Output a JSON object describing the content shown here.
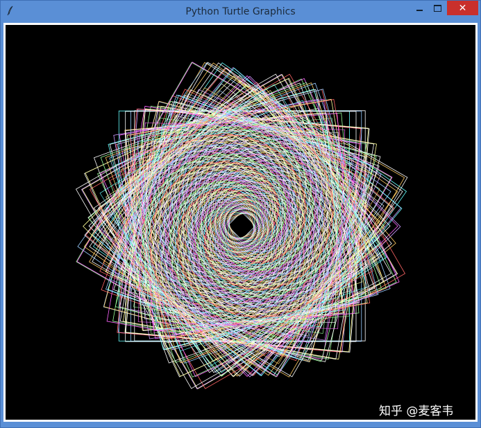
{
  "window": {
    "title": "Python Turtle Graphics",
    "app_icon": "feather-icon",
    "controls": {
      "minimize_icon": "minimize-icon",
      "maximize_icon": "maximize-icon",
      "close_label": "✕"
    }
  },
  "canvas": {
    "background": "#000000",
    "drawing": "turtle-rotating-squares",
    "colors": [
      "#ffffff",
      "#ffff99",
      "#99ff99",
      "#99ccff",
      "#ff6666",
      "#ff66ff",
      "#ffcc66",
      "#66ffff",
      "#cc99ff",
      "#ffffff",
      "#ffffff"
    ],
    "watermark": "知乎 @麦客韦"
  }
}
